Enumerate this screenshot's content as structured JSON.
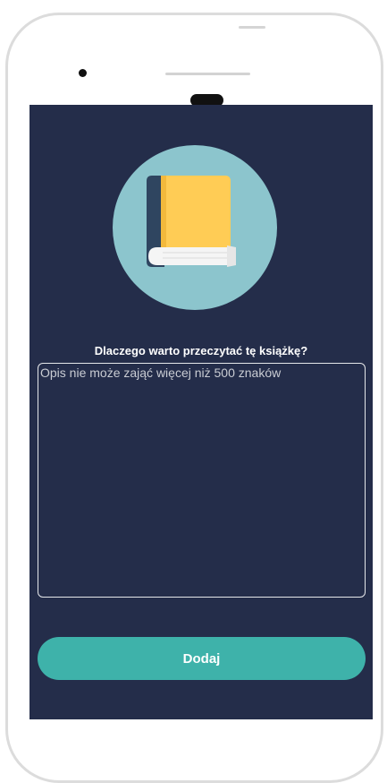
{
  "form": {
    "prompt_label": "Dlaczego warto przeczytać tę książkę?",
    "description_placeholder": "Opis nie może zająć więcej niż 500 znaków",
    "description_value": "",
    "submit_label": "Dodaj"
  },
  "illustration": {
    "icon": "book-icon",
    "circle_color": "#8cc5cd",
    "cover_color": "#ffcc55",
    "spine_color": "#2f4560",
    "pages_color": "#f5f5f5"
  },
  "colors": {
    "screen_background": "#242d4a",
    "accent": "#3eb2aa"
  }
}
